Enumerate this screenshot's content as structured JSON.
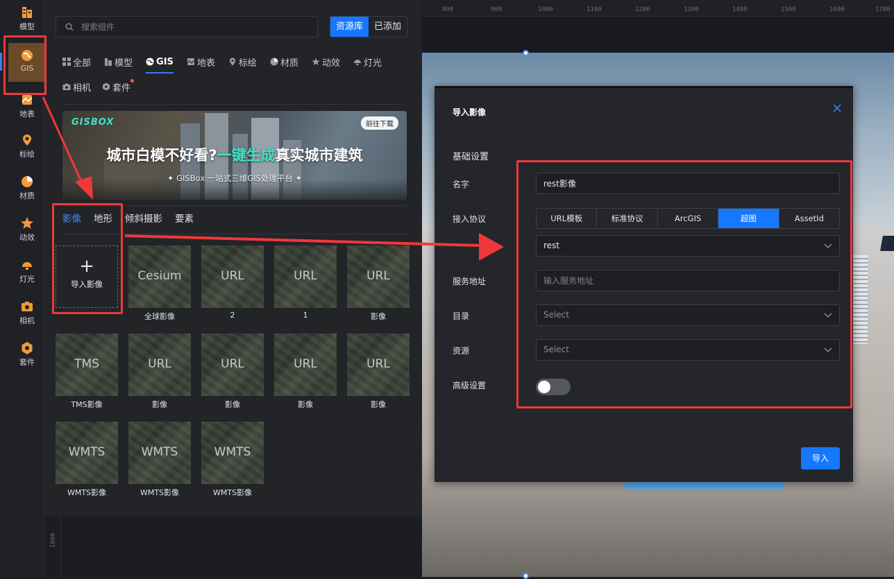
{
  "colors": {
    "accent": "#1677ff",
    "highlight": "#f0383a",
    "rail_active": "#6b4a2a",
    "teal": "#3ee2c8"
  },
  "ruler": {
    "ticks": [
      "800",
      "900",
      "1000",
      "1100",
      "1200",
      "1300",
      "1400",
      "1500",
      "1600",
      "1700"
    ],
    "left_label": "1000"
  },
  "rail": {
    "items": [
      {
        "label": "模型",
        "icon": "model-icon"
      },
      {
        "label": "GIS",
        "icon": "gis-icon"
      },
      {
        "label": "地表",
        "icon": "surface-icon"
      },
      {
        "label": "标绘",
        "icon": "marker-icon"
      },
      {
        "label": "材质",
        "icon": "material-icon"
      },
      {
        "label": "动效",
        "icon": "effect-icon"
      },
      {
        "label": "灯光",
        "icon": "light-icon"
      },
      {
        "label": "相机",
        "icon": "camera-icon"
      },
      {
        "label": "套件",
        "icon": "kit-icon"
      }
    ]
  },
  "panel": {
    "search_placeholder": "搜索组件",
    "lib_toggle": [
      "资源库",
      "已添加"
    ],
    "categories": [
      "全部",
      "模型",
      "GIS",
      "地表",
      "标绘",
      "材质",
      "动效",
      "灯光",
      "相机",
      "套件"
    ],
    "banner": {
      "logo": "GISBOX",
      "download": "前往下载",
      "headline_a": "城市白模不好看?",
      "headline_b": "一键生成",
      "headline_c": "真实城市建筑",
      "sub": "✦ GISBox 一站式三维GIS处理平台 ✦"
    },
    "subtabs": [
      "影像",
      "地形",
      "倾斜摄影",
      "要素"
    ],
    "import_card": {
      "plus": "+",
      "label": "导入影像"
    },
    "cards": [
      {
        "thumb": "Cesium",
        "caption": "全球影像"
      },
      {
        "thumb": "URL",
        "caption": "2"
      },
      {
        "thumb": "URL",
        "caption": "1"
      },
      {
        "thumb": "URL",
        "caption": "影像"
      },
      {
        "thumb": "TMS",
        "caption": "TMS影像"
      },
      {
        "thumb": "URL",
        "caption": "影像"
      },
      {
        "thumb": "URL",
        "caption": "影像"
      },
      {
        "thumb": "URL",
        "caption": "影像"
      },
      {
        "thumb": "URL",
        "caption": "影像"
      },
      {
        "thumb": "WMTS",
        "caption": "WMTS影像"
      },
      {
        "thumb": "WMTS",
        "caption": "WMTS影像"
      },
      {
        "thumb": "WMTS",
        "caption": "WMTS影像"
      }
    ]
  },
  "dialog": {
    "title": "导入影像",
    "section": "基础设置",
    "name_label": "名字",
    "name_value": "rest影像",
    "protocol_label": "接入协议",
    "protocols": [
      "URL模板",
      "标准协议",
      "ArcGIS",
      "超图",
      "AssetId"
    ],
    "protocol_selected": "rest",
    "service_label": "服务地址",
    "service_placeholder": "输入服务地址",
    "catalog_label": "目录",
    "catalog_placeholder": "Select",
    "resource_label": "资源",
    "resource_placeholder": "Select",
    "advanced_label": "高级设置",
    "import_button": "导入"
  }
}
